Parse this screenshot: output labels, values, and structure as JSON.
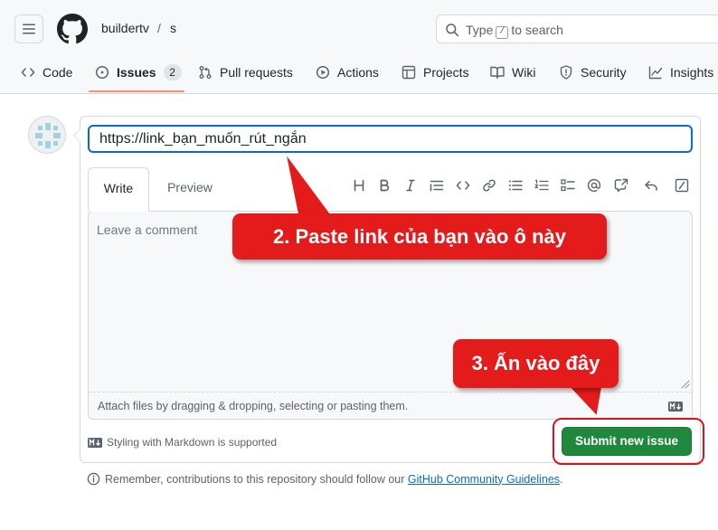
{
  "header": {
    "owner": "buildertv",
    "separator": "/",
    "repo": "s",
    "search_prefix": "Type",
    "search_key": "/",
    "search_suffix": "to search"
  },
  "tabs": [
    {
      "label": "Code",
      "icon": "code-icon"
    },
    {
      "label": "Issues",
      "icon": "issue-opened-icon",
      "count": "2",
      "active": true
    },
    {
      "label": "Pull requests",
      "icon": "git-pull-request-icon"
    },
    {
      "label": "Actions",
      "icon": "play-icon"
    },
    {
      "label": "Projects",
      "icon": "table-icon"
    },
    {
      "label": "Wiki",
      "icon": "book-icon"
    },
    {
      "label": "Security",
      "icon": "shield-icon"
    },
    {
      "label": "Insights",
      "icon": "graph-icon"
    }
  ],
  "form": {
    "title_value": "https://link_bạn_muốn_rút_ngắn",
    "write_tab": "Write",
    "preview_tab": "Preview",
    "comment_placeholder": "Leave a comment",
    "attach_hint": "Attach files by dragging & dropping, selecting or pasting them.",
    "markdown_note": "Styling with Markdown is supported",
    "submit_label": "Submit new issue",
    "remember_text": "Remember, contributions to this repository should follow our",
    "guidelines_link": "GitHub Community Guidelines",
    "remember_end": "."
  },
  "toolbar": [
    "heading-icon",
    "bold-icon",
    "italic-icon",
    "quote-icon",
    "code-icon",
    "link-icon",
    "unordered-list-icon",
    "ordered-list-icon",
    "task-list-icon",
    "mention-icon",
    "cross-reference-icon",
    "reply-icon",
    "slash-command-icon"
  ],
  "annotations": {
    "step2": "2. Paste link của bạn vào ô này",
    "step3": "3. Ấn vào đây",
    "color": "#e41b1b"
  },
  "colors": {
    "accent": "#0969da",
    "submit": "#1f883d",
    "tab_underline": "#fd8c73"
  }
}
